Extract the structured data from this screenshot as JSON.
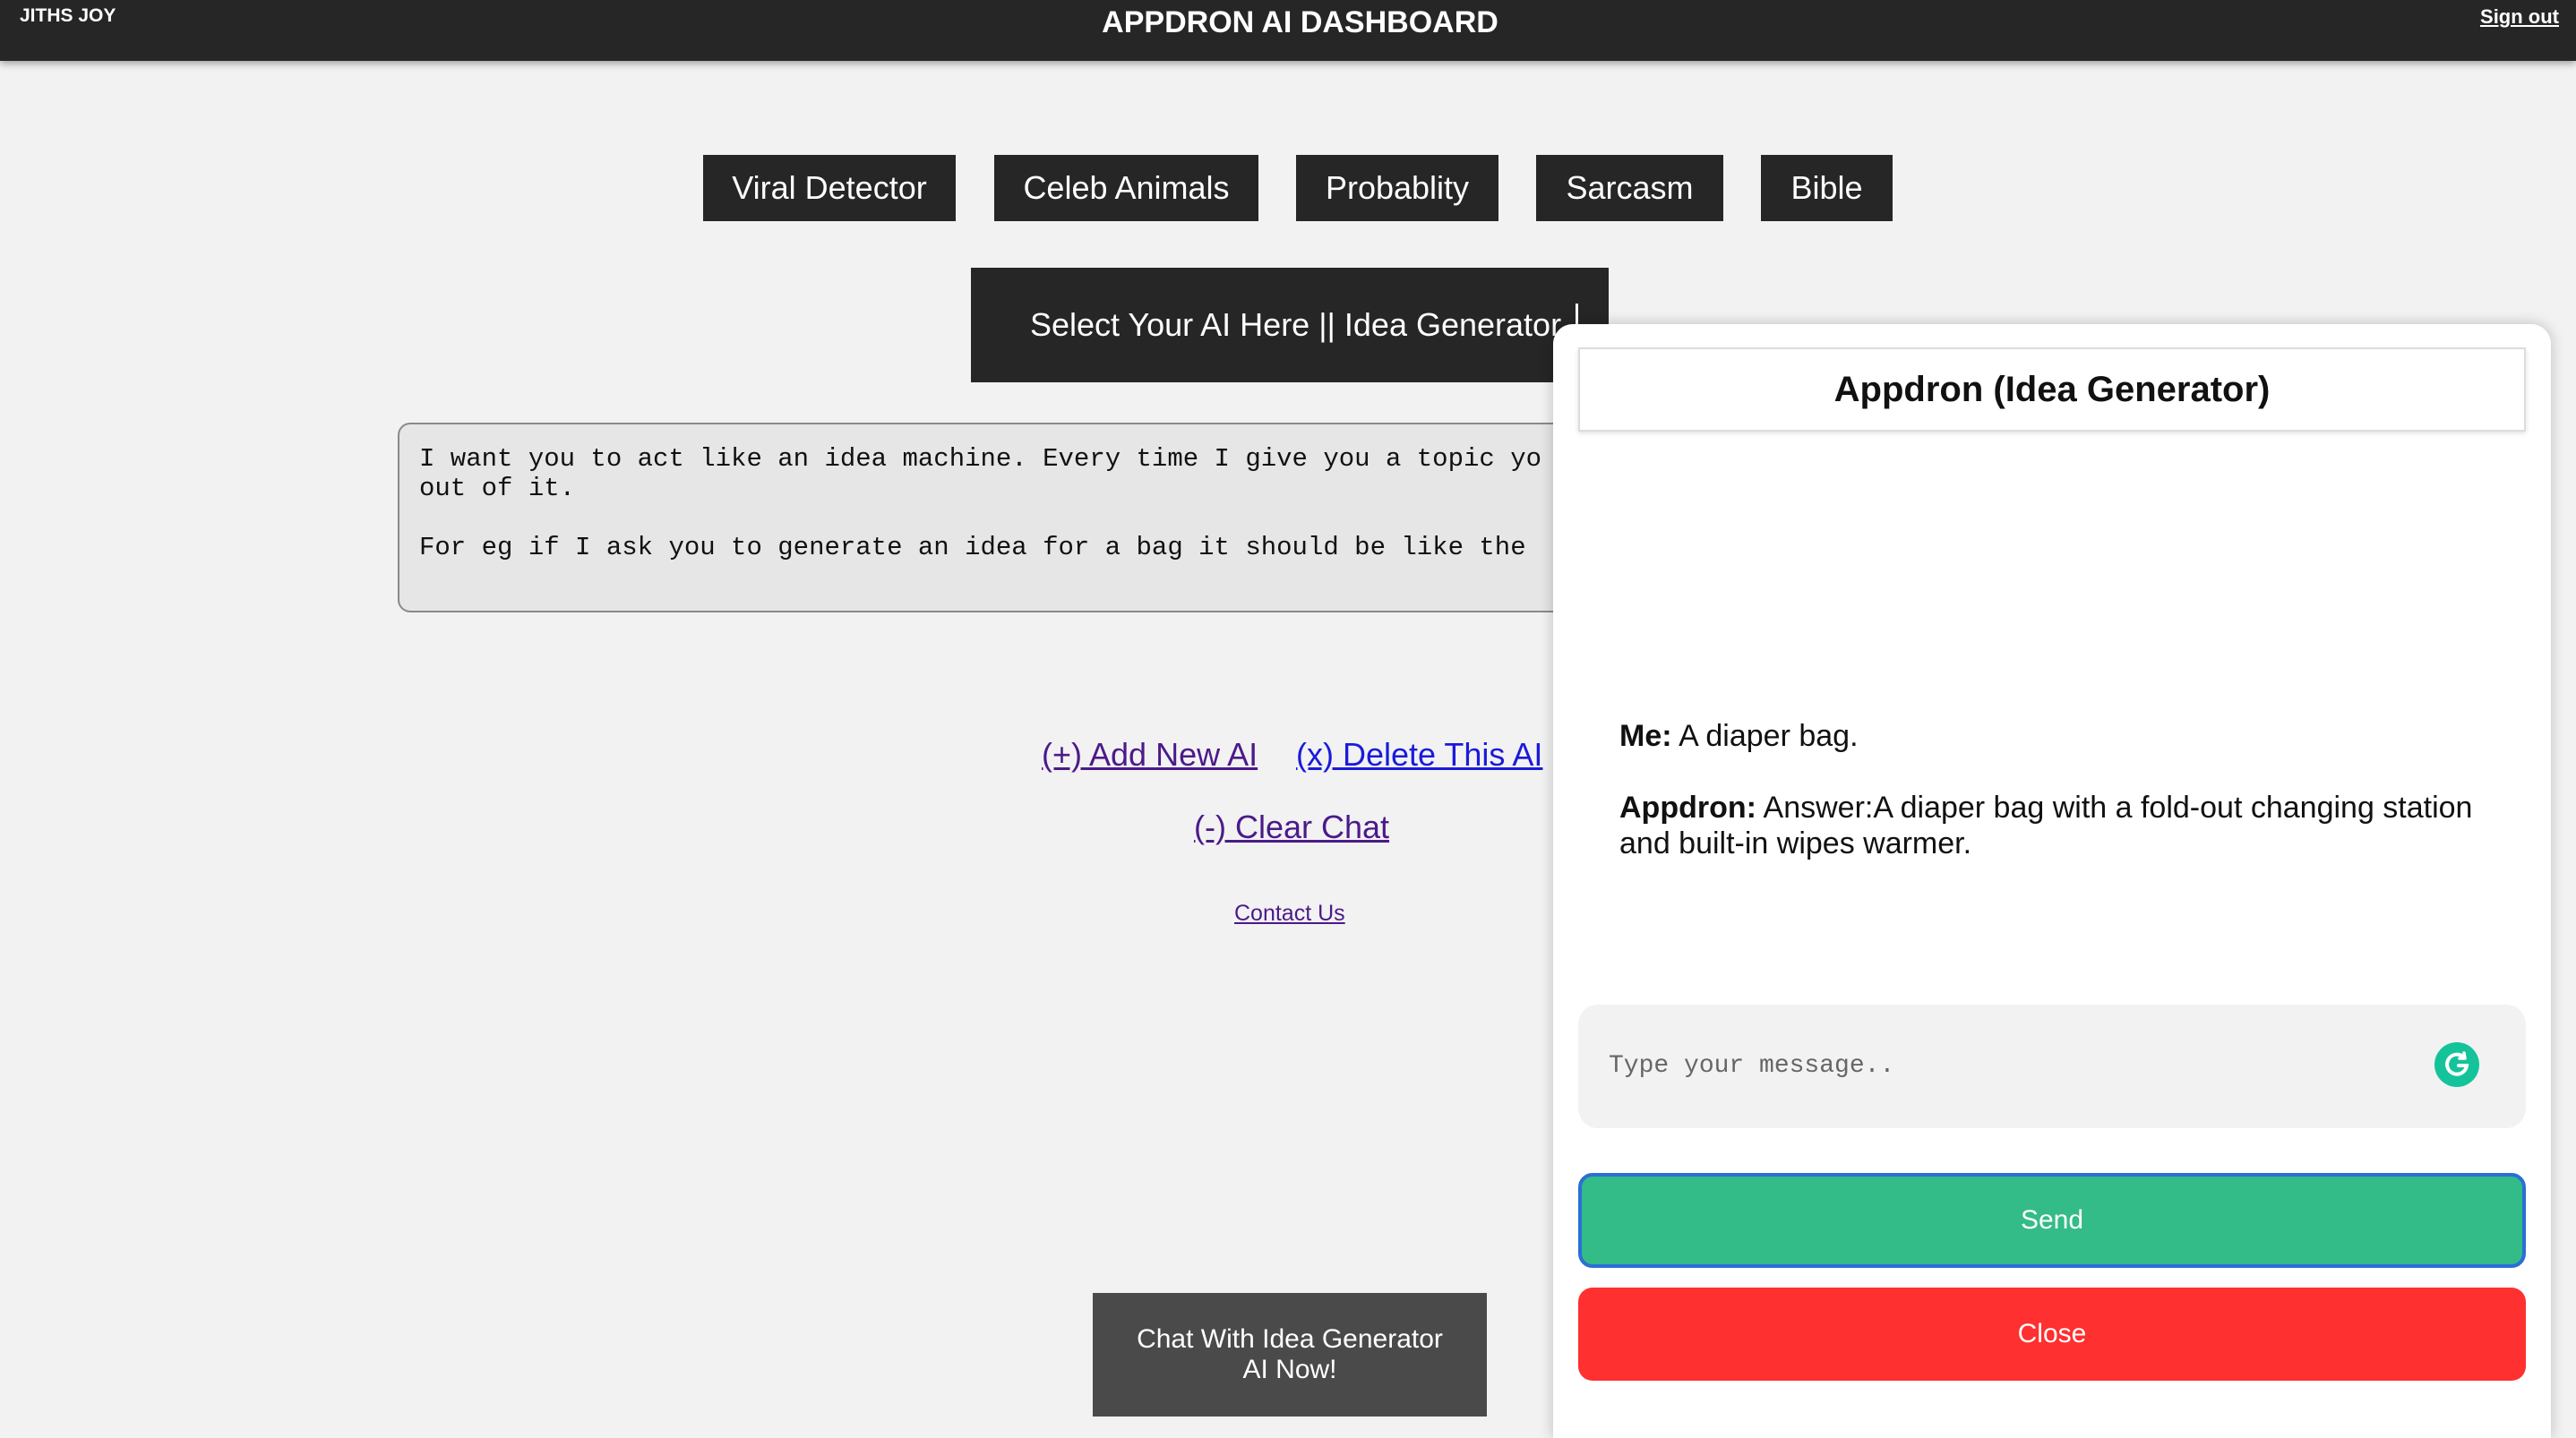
{
  "header": {
    "user_name": "JITHS JOY",
    "title": "APPDRON AI DASHBOARD",
    "sign_out": "Sign out"
  },
  "presets": [
    {
      "label": "Viral Detector"
    },
    {
      "label": "Celeb Animals"
    },
    {
      "label": "Probablity"
    },
    {
      "label": "Sarcasm"
    },
    {
      "label": "Bible"
    }
  ],
  "selector": {
    "label": "Select Your AI Here || Idea Generator"
  },
  "prompt": {
    "text": "I want you to act like an idea machine. Every time I give you a topic yo\nout of it.\n\nFor eg if I ask you to generate an idea for a bag it should be like the"
  },
  "links": {
    "add_new": "(+) Add New AI ",
    "delete": "(x) Delete This AI",
    "clear_chat": "(-) Clear Chat",
    "contact": "Contact Us"
  },
  "chat_now_button": "Chat With Idea Generator AI Now!",
  "chat": {
    "title": "Appdron (Idea Generator)",
    "messages": [
      {
        "sender": "Me:",
        "text": " A diaper bag."
      },
      {
        "sender": "Appdron:",
        "text": " Answer:A diaper bag with a fold-out changing station and built-in wipes warmer."
      }
    ],
    "input_placeholder": "Type your message..",
    "send_label": "Send",
    "close_label": "Close"
  },
  "colors": {
    "topbar": "#262626",
    "background": "#f2f2f2",
    "send": "#33bb88",
    "close": "#ff3030",
    "grammarly": "#15c39a"
  }
}
